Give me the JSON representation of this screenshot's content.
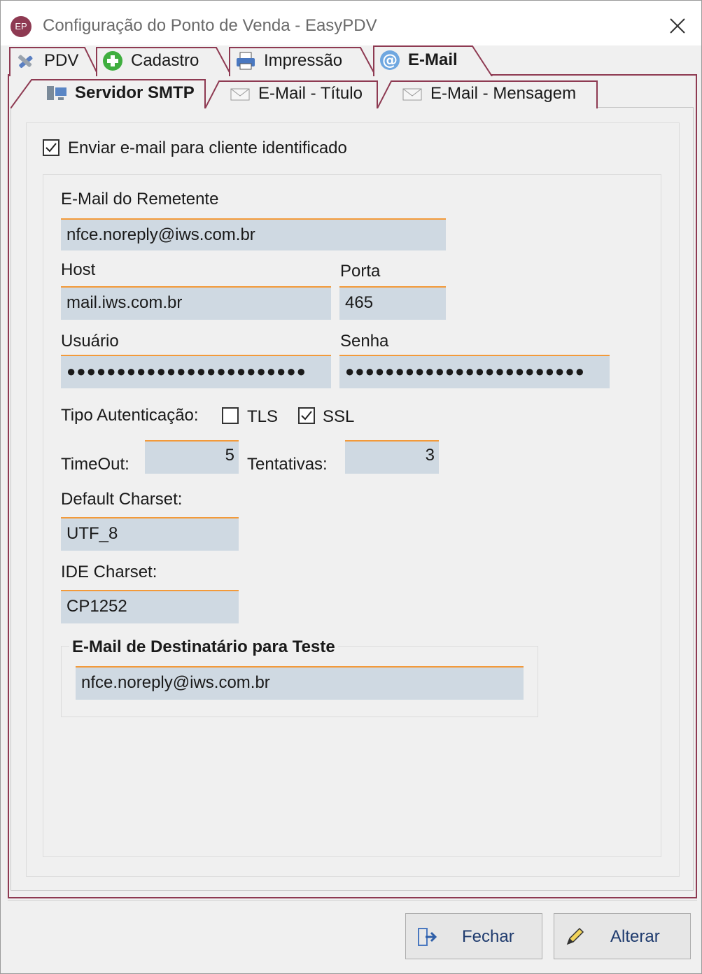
{
  "window": {
    "app_icon_text": "EP",
    "title": "Configuração do Ponto de Venda - EasyPDV"
  },
  "outer_tabs": [
    {
      "label": "PDV",
      "icon": "tools-icon"
    },
    {
      "label": "Cadastro",
      "icon": "add-icon"
    },
    {
      "label": "Impressão",
      "icon": "printer-icon"
    },
    {
      "label": "E-Mail",
      "icon": "at-icon",
      "active": true
    }
  ],
  "inner_tabs": [
    {
      "label": "Servidor SMTP",
      "icon": "server-icon",
      "active": true
    },
    {
      "label": "E-Mail - Título",
      "icon": "envelope-icon"
    },
    {
      "label": "E-Mail - Mensagem",
      "icon": "envelope-icon"
    }
  ],
  "form": {
    "send_email_label": "Enviar e-mail para cliente identificado",
    "send_email_checked": true,
    "sender_label": "E-Mail do Remetente",
    "sender_value": "nfce.noreply@iws.com.br",
    "host_label": "Host",
    "host_value": "mail.iws.com.br",
    "port_label": "Porta",
    "port_value": "465",
    "user_label": "Usuário",
    "user_value": "●●●●●●●●●●●●●●●●●●●●●●●●",
    "password_label": "Senha",
    "password_value": "●●●●●●●●●●●●●●●●●●●●●●●●",
    "auth_label": "Tipo Autenticação:",
    "tls_label": "TLS",
    "tls_checked": false,
    "ssl_label": "SSL",
    "ssl_checked": true,
    "timeout_label": "TimeOut:",
    "timeout_value": "5",
    "attempts_label": "Tentativas:",
    "attempts_value": "3",
    "default_charset_label": "Default Charset:",
    "default_charset_value": "UTF_8",
    "ide_charset_label": "IDE Charset:",
    "ide_charset_value": "CP1252",
    "test_group_label": "E-Mail de Destinatário para Teste",
    "test_recipient_value": "nfce.noreply@iws.com.br"
  },
  "buttons": {
    "close_label": "Fechar",
    "edit_label": "Alterar"
  },
  "colors": {
    "accent_border": "#8e3a52",
    "field_bg": "#cfd9e2",
    "field_top_border": "#f39a3a"
  }
}
